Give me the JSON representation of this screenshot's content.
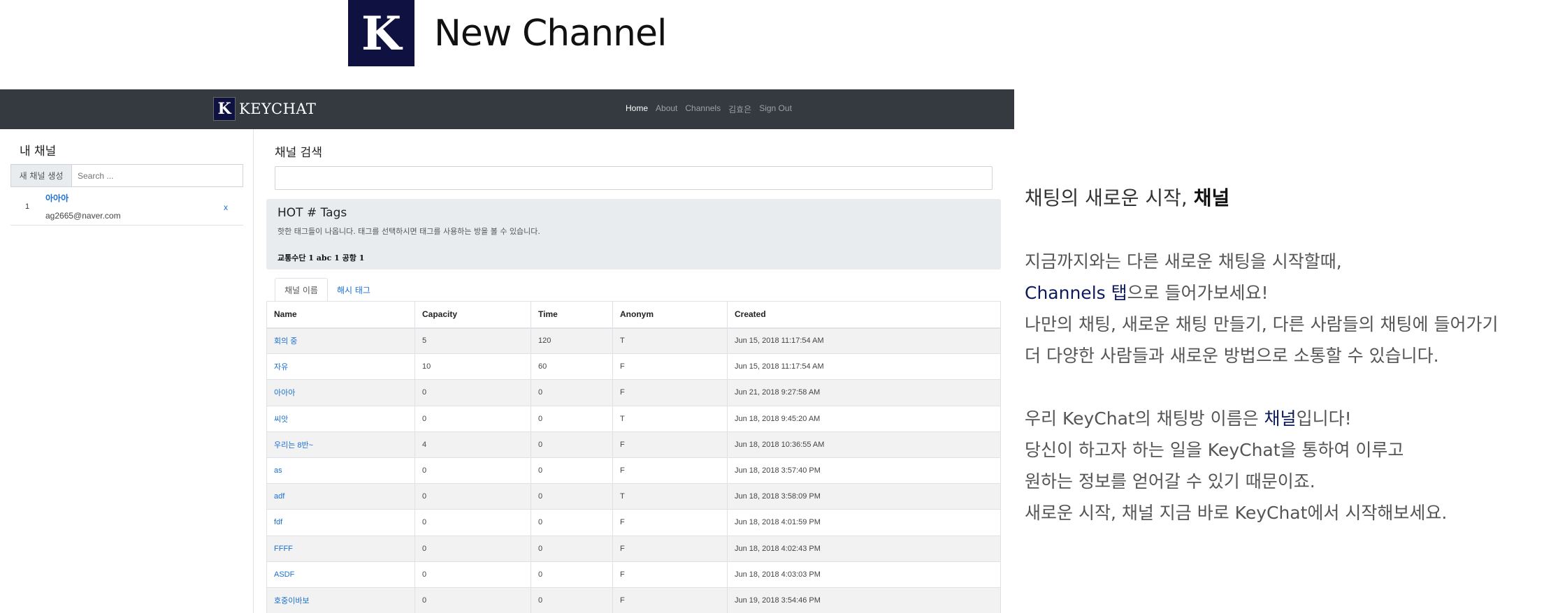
{
  "banner": {
    "logo": "K",
    "title": "New Channel"
  },
  "navbar": {
    "brand_logo": "K",
    "brand_name": "KEYCHAT",
    "links": [
      "Home",
      "About",
      "Channels",
      "김효은",
      "Sign Out"
    ]
  },
  "sidebar": {
    "title": "내 채널",
    "new_button": "새 채널 생성",
    "search_placeholder": "Search ...",
    "channels": [
      {
        "num": "1",
        "name": "아아아",
        "email": "ag2665@naver.com",
        "remove": "x"
      }
    ]
  },
  "main": {
    "search_title": "채널 검색",
    "hot_title": "HOT # Tags",
    "hot_desc": "핫한 태그들이 나옵니다. 태그를 선택하시면 태그를 사용하는 방을 볼 수 있습니다.",
    "hot_tags": "교통수단 1 abc 1  공항 1",
    "tabs": [
      "채널 이름",
      "해시 태그"
    ],
    "columns": [
      "Name",
      "Capacity",
      "Time",
      "Anonym",
      "Created"
    ],
    "rows": [
      [
        "회의 중",
        "5",
        "120",
        "T",
        "Jun 15, 2018 11:17:54 AM"
      ],
      [
        "자유",
        "10",
        "60",
        "F",
        "Jun 15, 2018 11:17:54 AM"
      ],
      [
        "아아아",
        "0",
        "0",
        "F",
        "Jun 21, 2018 9:27:58 AM"
      ],
      [
        "씨앗",
        "0",
        "0",
        "T",
        "Jun 18, 2018 9:45:20 AM"
      ],
      [
        "우리는 8반~",
        "4",
        "0",
        "F",
        "Jun 18, 2018 10:36:55 AM"
      ],
      [
        "as",
        "0",
        "0",
        "F",
        "Jun 18, 2018 3:57:40 PM"
      ],
      [
        "adf",
        "0",
        "0",
        "T",
        "Jun 18, 2018 3:58:09 PM"
      ],
      [
        "fdf",
        "0",
        "0",
        "F",
        "Jun 18, 2018 4:01:59 PM"
      ],
      [
        "FFFF",
        "0",
        "0",
        "F",
        "Jun 18, 2018 4:02:43 PM"
      ],
      [
        "ASDF",
        "0",
        "0",
        "F",
        "Jun 18, 2018 4:03:03 PM"
      ],
      [
        "호중이바보",
        "0",
        "0",
        "F",
        "Jun 19, 2018 3:54:46 PM"
      ]
    ]
  },
  "description": {
    "title_plain": "채팅의 새로운 시작, ",
    "title_bold": "채널",
    "line1": "지금까지와는 다른 새로운 채팅을 시작할때,",
    "line2_hl": "Channels 탭",
    "line2_rest": "으로 들어가보세요!",
    "line3": "나만의 채팅, 새로운 채팅 만들기, 다른 사람들의 채팅에 들어가기",
    "line4": "더 다양한 사람들과 새로운 방법으로 소통할 수 있습니다.",
    "line5_a": "우리 KeyChat의 채팅방 이름은 ",
    "line5_hl": "채널",
    "line5_b": "입니다!",
    "line6": "당신이 하고자 하는 일을 KeyChat을 통하여 이루고",
    "line7": "원하는 정보를 얻어갈 수 있기 때문이죠.",
    "line8": "새로운 시작, 채널 지금 바로 KeyChat에서 시작해보세요."
  }
}
